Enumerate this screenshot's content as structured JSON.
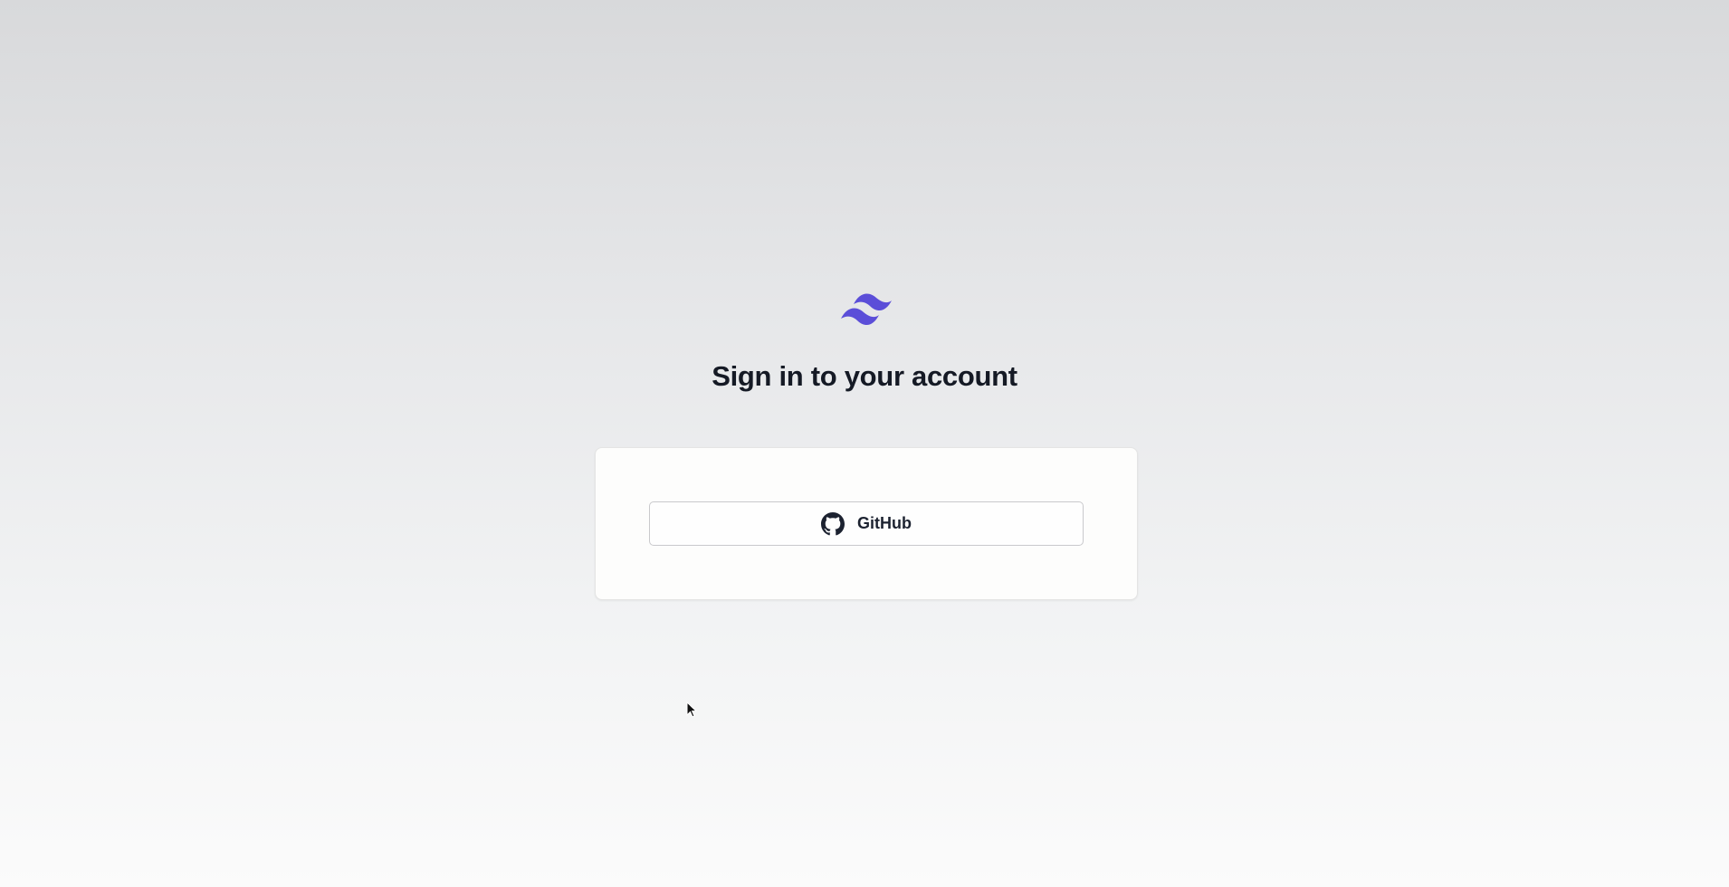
{
  "logo": {
    "icon": "tailwind-waves-icon",
    "color": "#5b4ed8"
  },
  "heading": {
    "title": "Sign in to your account"
  },
  "auth": {
    "providers": [
      {
        "label": "GitHub",
        "icon": "github-icon"
      }
    ]
  },
  "colors": {
    "accent": "#5b4ed8",
    "text": "#151a25",
    "card_bg": "#fdfdfc",
    "button_border": "#c9c9cc"
  }
}
